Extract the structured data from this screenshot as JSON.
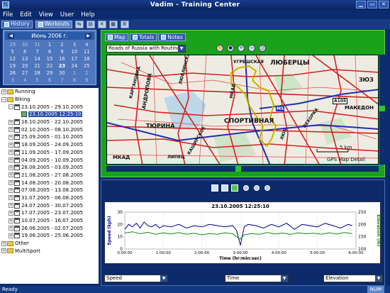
{
  "window": {
    "title": "Vadim - Training Center",
    "app_icon": "TC"
  },
  "menu": [
    "File",
    "Edit",
    "View",
    "User",
    "Help"
  ],
  "toolbar": {
    "history_label": "History",
    "workouts_label": "Workouts"
  },
  "calendar": {
    "month": "Июнь 2006 г.",
    "weeks": [
      [
        "29",
        "30",
        "31",
        "1",
        "2",
        "3",
        "4"
      ],
      [
        "5",
        "6",
        "7",
        "8",
        "9",
        "10",
        "11"
      ],
      [
        "12",
        "13",
        "14",
        "15",
        "16",
        "17",
        "18"
      ],
      [
        "19",
        "20",
        "21",
        "22",
        "23",
        "24",
        "25"
      ],
      [
        "26",
        "27",
        "28",
        "29",
        "30",
        "1",
        "2"
      ],
      [
        "3",
        "4",
        "5",
        "6",
        "7",
        "8",
        "9"
      ]
    ],
    "today": "23"
  },
  "tree": {
    "items": [
      {
        "label": "Running",
        "type": "folder",
        "indent": 0,
        "exp": "+"
      },
      {
        "label": "Biking",
        "type": "folder",
        "indent": 0,
        "exp": "-"
      },
      {
        "label": "23.10.2005 - 29.10.2005",
        "type": "week",
        "indent": 1,
        "exp": "-"
      },
      {
        "label": "23.10.2005 12:25:10",
        "type": "workout",
        "indent": 2,
        "exp": "",
        "selected": true
      },
      {
        "label": "16.10.2005 - 22.10.2005",
        "type": "week",
        "indent": 1,
        "exp": "+"
      },
      {
        "label": "02.10.2005 - 08.10.2005",
        "type": "week",
        "indent": 1,
        "exp": "+"
      },
      {
        "label": "25.09.2005 - 01.10.2005",
        "type": "week",
        "indent": 1,
        "exp": "+"
      },
      {
        "label": "18.09.2005 - 24.09.2005",
        "type": "week",
        "indent": 1,
        "exp": "+"
      },
      {
        "label": "11.09.2005 - 17.09.2005",
        "type": "week",
        "indent": 1,
        "exp": "+"
      },
      {
        "label": "04.09.2005 - 10.09.2005",
        "type": "week",
        "indent": 1,
        "exp": "+"
      },
      {
        "label": "28.08.2005 - 03.09.2005",
        "type": "week",
        "indent": 1,
        "exp": "+"
      },
      {
        "label": "21.08.2005 - 27.08.2005",
        "type": "week",
        "indent": 1,
        "exp": "+"
      },
      {
        "label": "14.08.2005 - 20.08.2005",
        "type": "week",
        "indent": 1,
        "exp": "+"
      },
      {
        "label": "07.08.2005 - 13.08.2005",
        "type": "week",
        "indent": 1,
        "exp": "+"
      },
      {
        "label": "31.07.2005 - 06.08.2005",
        "type": "week",
        "indent": 1,
        "exp": "+"
      },
      {
        "label": "24.07.2005 - 30.07.2005",
        "type": "week",
        "indent": 1,
        "exp": "+"
      },
      {
        "label": "17.07.2005 - 23.07.2005",
        "type": "week",
        "indent": 1,
        "exp": "+"
      },
      {
        "label": "10.07.2005 - 16.07.2005",
        "type": "week",
        "indent": 1,
        "exp": "+"
      },
      {
        "label": "26.06.2005 - 02.07.2005",
        "type": "week",
        "indent": 1,
        "exp": "+"
      },
      {
        "label": "19.06.2005 - 25.06.2005",
        "type": "week",
        "indent": 1,
        "exp": "+"
      },
      {
        "label": "Other",
        "type": "folder",
        "indent": 0,
        "exp": "+"
      },
      {
        "label": "MultiSport",
        "type": "folder",
        "indent": 0,
        "exp": "+"
      }
    ]
  },
  "map": {
    "tabs": [
      "Map",
      "Totals",
      "Notes"
    ],
    "map_source": "Roads of Russia with Routing",
    "scale_label": "5 km",
    "detail_label": "GPS Map Detail",
    "labels": {
      "lyubertsy": "ЛЮБЕРЦЫ",
      "ugreshskaya": "УГРЕШСКАЯ",
      "sportivnaya": "СПОРТИВНАЯ",
      "turino": "ТЮРИНА",
      "lublinskaya": "ЛЮБЛИНСКАЯ",
      "andropova": "АНДРОПОВА",
      "kashirskoe": "КАШИРСКОЕ",
      "kolomenskaya": "КАРГАНОВКА",
      "pekhorka": "ПЕХОРКА",
      "makedon": "МАКЕДОН",
      "zyuz": "ЗЮЗ",
      "road_m5": "M5",
      "road_a105": "A105",
      "lipetsk": "ЛИПЕЦ",
      "mkad": "МКАД",
      "mkad2": "МКАД",
      "lbc": "ЛЮБ"
    }
  },
  "chart": {
    "selectors": {
      "left": "Speed",
      "middle": "Time",
      "right": "Elevation"
    }
  },
  "chart_data": {
    "type": "line",
    "title": "23.10.2005 12:25:10",
    "xlabel": "Time (hr:min:sec)",
    "ylabel": "Speed (kph)",
    "y2label": "Elevation (m)",
    "x_ticks": [
      "0:00:00",
      "1:00:00",
      "2:00:00",
      "3:00:00",
      "4:00:00",
      "5:00:00",
      "6:00:00"
    ],
    "y_ticks": [
      "0",
      "10",
      "20",
      "30"
    ],
    "y2_ticks": [
      "100",
      "150",
      "200",
      "250"
    ],
    "xlim": [
      0,
      6
    ],
    "ylim": [
      0,
      30
    ],
    "y2lim": [
      100,
      250
    ],
    "grid": true,
    "series": [
      {
        "name": "Speed",
        "axis": "left",
        "color": "#00008b",
        "x": [
          0,
          0.1,
          0.2,
          0.3,
          0.4,
          0.5,
          0.6,
          0.7,
          0.8,
          0.9,
          1.0,
          1.2,
          1.4,
          1.6,
          1.8,
          2.0,
          2.2,
          2.4,
          2.6,
          2.8,
          2.9,
          3.0,
          3.1,
          3.2,
          3.4,
          3.6,
          3.8,
          4.0,
          4.2,
          4.4,
          4.6,
          4.8,
          5.0,
          5.2,
          5.4,
          5.6,
          5.8,
          5.9
        ],
        "values": [
          16,
          20,
          18,
          21,
          17,
          22,
          19,
          18,
          20,
          17,
          19,
          18,
          20,
          17,
          19,
          18,
          20,
          19,
          18,
          19,
          15,
          3,
          18,
          20,
          19,
          17,
          20,
          18,
          21,
          16,
          20,
          19,
          18,
          21,
          19,
          17,
          20,
          19
        ]
      },
      {
        "name": "Elevation",
        "axis": "right",
        "color": "#128a12",
        "x": [
          0,
          0.2,
          0.4,
          0.6,
          0.8,
          1.0,
          1.2,
          1.4,
          1.6,
          1.8,
          2.0,
          2.2,
          2.4,
          2.6,
          2.8,
          2.9,
          3.0,
          3.1,
          3.3,
          3.5,
          3.7,
          3.9,
          4.1,
          4.3,
          4.5,
          4.7,
          4.9,
          5.1,
          5.3,
          5.5,
          5.7,
          5.9
        ],
        "values": [
          165,
          170,
          162,
          168,
          160,
          166,
          161,
          167,
          160,
          164,
          158,
          163,
          160,
          166,
          162,
          150,
          140,
          158,
          163,
          160,
          167,
          161,
          165,
          159,
          166,
          162,
          164,
          160,
          166,
          161,
          167,
          163
        ]
      }
    ]
  },
  "status": {
    "text": "Ready",
    "num": "NUM"
  }
}
